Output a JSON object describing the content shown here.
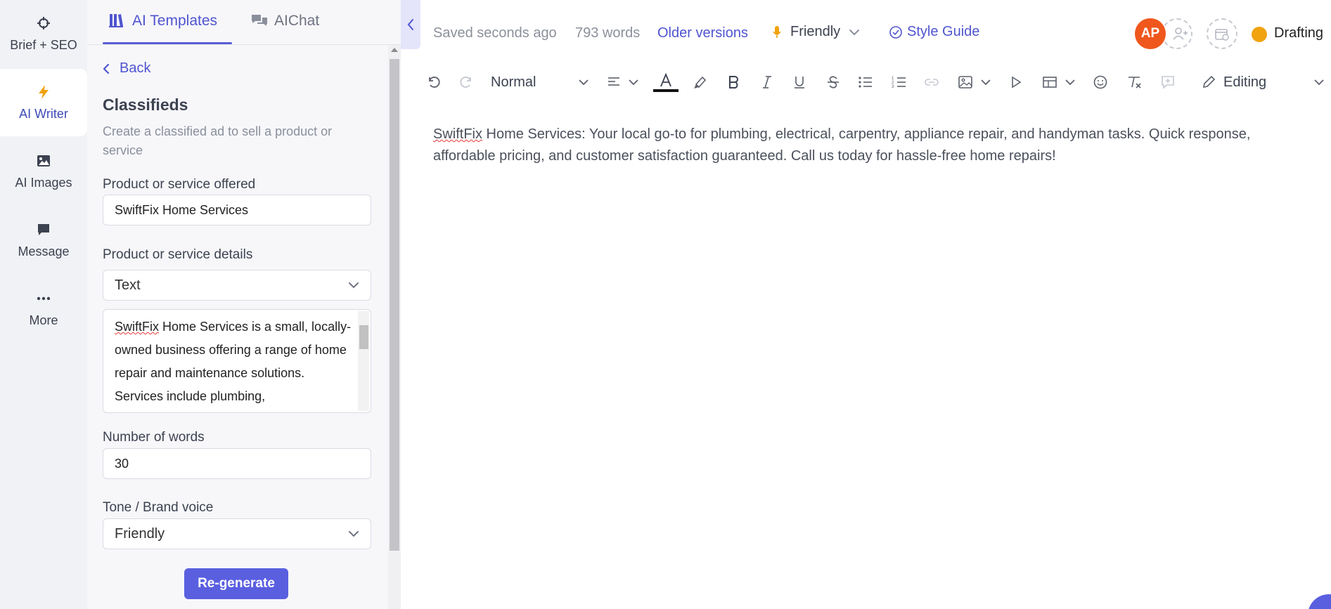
{
  "rail": {
    "items": [
      {
        "label": "Brief + SEO",
        "icon": "crosshair-icon"
      },
      {
        "label": "AI Writer",
        "icon": "lightning-icon"
      },
      {
        "label": "AI Images",
        "icon": "image-icon"
      },
      {
        "label": "Message",
        "icon": "message-icon"
      },
      {
        "label": "More",
        "icon": "more-icon"
      }
    ],
    "active_index": 1
  },
  "panel": {
    "tabs": [
      {
        "label": "AI Templates",
        "icon": "templates-icon"
      },
      {
        "label": "AIChat",
        "icon": "chat-icon"
      }
    ],
    "back_label": "Back",
    "title": "Classifieds",
    "description": "Create a classified ad to sell a product or service",
    "fields": {
      "product": {
        "label": "Product or service offered",
        "value": "SwiftFix Home Services"
      },
      "details": {
        "label": "Product or service details",
        "type_value": "Text",
        "text_first_word": "SwiftFix",
        "text_rest": " Home Services is a small, locally-owned business offering a range of home repair and maintenance solutions. Services include plumbing,"
      },
      "words": {
        "label": "Number of words",
        "value": "30"
      },
      "tone": {
        "label": "Tone / Brand voice",
        "value": "Friendly"
      }
    },
    "regenerate_label": "Re-generate"
  },
  "topbar": {
    "saved": "Saved seconds ago",
    "word_count": "793 words",
    "older_versions": "Older versions",
    "tone": "Friendly",
    "style_guide": "Style Guide",
    "avatar_initials": "AP",
    "status": "Drafting",
    "status_color": "#f0a20f"
  },
  "toolbar": {
    "text_style": "Normal",
    "mode": "Editing"
  },
  "document": {
    "first_word": "SwiftFix",
    "text": " Home Services: Your local go-to for plumbing, electrical, carpentry, appliance repair, and handyman tasks. Quick response, affordable pricing, and customer satisfaction guaranteed. Call us today for hassle-free home repairs!"
  },
  "colors": {
    "accent": "#5a5fe0",
    "link": "#4f55cf",
    "avatar": "#f0571d"
  }
}
